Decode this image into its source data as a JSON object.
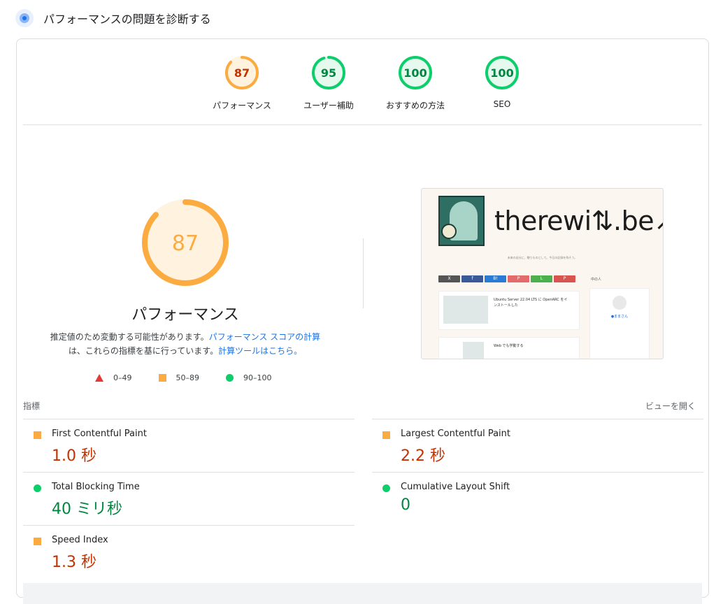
{
  "header": {
    "title": "パフォーマンスの問題を診断する"
  },
  "categories": [
    {
      "score": "87",
      "label": "パフォーマンス",
      "fraction": 0.87,
      "color": "#fbab3f",
      "text_color": "#c33300",
      "fill": "#fff3e0"
    },
    {
      "score": "95",
      "label": "ユーザー補助",
      "fraction": 0.95,
      "color": "#0cce6b",
      "text_color": "#018642",
      "fill": "#e6f9ee"
    },
    {
      "score": "100",
      "label": "おすすめの方法",
      "fraction": 1.0,
      "color": "#0cce6b",
      "text_color": "#018642",
      "fill": "#e6f9ee"
    },
    {
      "score": "100",
      "label": "SEO",
      "fraction": 1.0,
      "color": "#0cce6b",
      "text_color": "#018642",
      "fill": "#e6f9ee"
    }
  ],
  "main_gauge": {
    "score": "87",
    "label": "パフォーマンス",
    "fraction": 0.87,
    "color": "#fbab3f",
    "fill": "#fff3e0"
  },
  "description": {
    "part1": "推定値のため変動する可能性があります。",
    "link1": "パフォーマンス スコアの計算",
    "part2": "は、これらの指標を基に行っています。",
    "link2": "計算ツールはこちら。"
  },
  "legend": {
    "poor": "0–49",
    "average": "50–89",
    "good": "90–100"
  },
  "screenshot": {
    "logo_text": "therewi⇅.be↗",
    "tagline": "未来の自分に、贈りものとして。今日の記録を残そう。",
    "sidebar_heading": "中の人",
    "post1_title": "Ubuntu Server 22.04 LTS に OpenARC をインストールした",
    "post2_title": "Web でも学動する",
    "profile_name": "●ままさん",
    "share_buttons": [
      "X",
      "f",
      "B!",
      "P",
      "L",
      "P"
    ]
  },
  "metrics_section": {
    "label": "指標",
    "expand": "ビューを開く"
  },
  "metrics": [
    {
      "title": "First Contentful Paint",
      "value": "1.0 秒",
      "status": "average"
    },
    {
      "title": "Largest Contentful Paint",
      "value": "2.2 秒",
      "status": "average"
    },
    {
      "title": "Total Blocking Time",
      "value": "40 ミリ秒",
      "status": "good"
    },
    {
      "title": "Cumulative Layout Shift",
      "value": "0",
      "status": "good"
    },
    {
      "title": "Speed Index",
      "value": "1.3 秒",
      "status": "average"
    }
  ],
  "colors": {
    "average": "#fbab3f",
    "good": "#0cce6b",
    "poor": "#e53935",
    "link": "#1a73e8"
  }
}
